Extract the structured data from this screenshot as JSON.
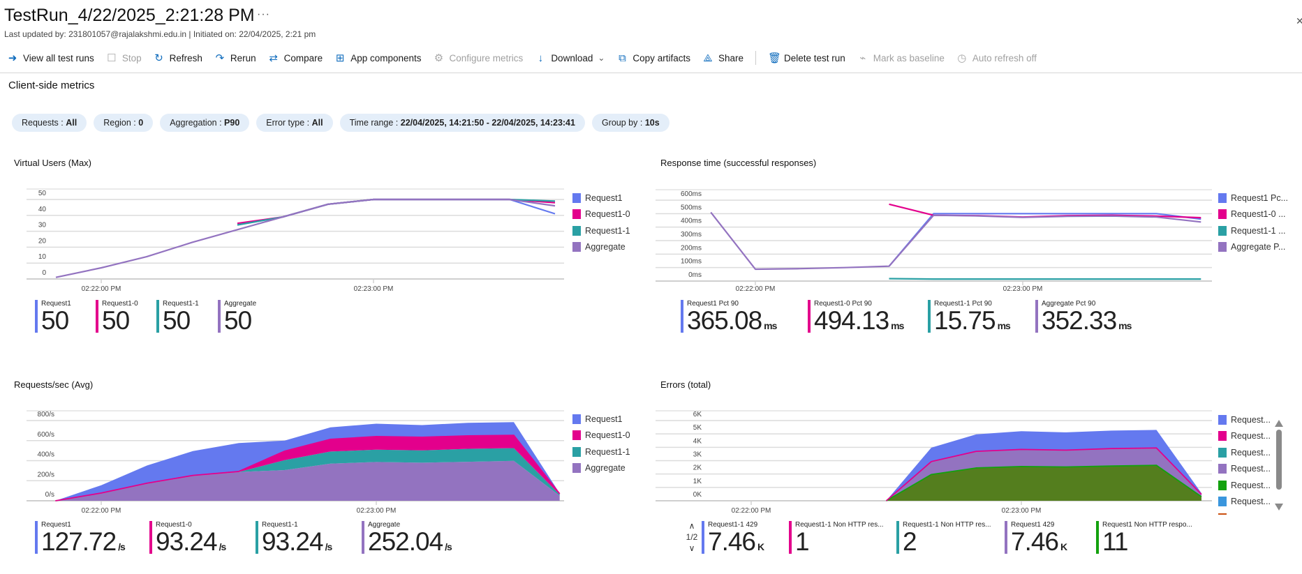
{
  "header": {
    "title": "TestRun_4/22/2025_2:21:28 PM",
    "more": "···",
    "subtitle": "Last updated by: 231801057@rajalakshmi.edu.in | Initiated on: 22/04/2025, 2:21 pm",
    "close": "✕"
  },
  "toolbar": [
    {
      "label": "View all test runs",
      "icon": "arrow-circle-icon",
      "glyph": "➜",
      "disabled": false
    },
    {
      "label": "Stop",
      "icon": "stop-icon",
      "glyph": "☐",
      "disabled": true
    },
    {
      "label": "Refresh",
      "icon": "refresh-icon",
      "glyph": "↻",
      "disabled": false
    },
    {
      "label": "Rerun",
      "icon": "rerun-icon",
      "glyph": "↷",
      "disabled": false
    },
    {
      "label": "Compare",
      "icon": "compare-icon",
      "glyph": "⇄",
      "disabled": false
    },
    {
      "label": "App components",
      "icon": "app-components-icon",
      "glyph": "⊞",
      "disabled": false
    },
    {
      "label": "Configure metrics",
      "icon": "gear-icon",
      "glyph": "⚙",
      "disabled": true
    },
    {
      "label": "Download",
      "icon": "download-icon",
      "glyph": "↓",
      "disabled": false,
      "chevron": "⌄"
    },
    {
      "label": "Copy artifacts",
      "icon": "copy-icon",
      "glyph": "⧉",
      "disabled": false
    },
    {
      "label": "Share",
      "icon": "share-icon",
      "glyph": "⟁",
      "disabled": false
    },
    {
      "label": "Delete test run",
      "icon": "trash-icon",
      "glyph": "🗑",
      "disabled": false
    },
    {
      "label": "Mark as baseline",
      "icon": "baseline-icon",
      "glyph": "⌁",
      "disabled": true
    },
    {
      "label": "Auto refresh off",
      "icon": "clock-icon",
      "glyph": "◷",
      "disabled": true
    }
  ],
  "section_title": "Client-side metrics",
  "filters": [
    {
      "key": "Requests : ",
      "value": "All"
    },
    {
      "key": "Region : ",
      "value": "0"
    },
    {
      "key": "Aggregation : ",
      "value": "P90"
    },
    {
      "key": "Error type : ",
      "value": "All"
    },
    {
      "key": "Time range : ",
      "value": "22/04/2025, 14:21:50 - 22/04/2025, 14:23:41"
    },
    {
      "key": "Group by : ",
      "value": "10s"
    }
  ],
  "colors": {
    "request1": "#6479ef",
    "request1_0": "#e3008c",
    "request1_1": "#2aa0a4",
    "aggregate": "#9373c0",
    "green": "#13a10e",
    "green_fill": "#547e1e",
    "light_blue": "#3a96dd",
    "orange": "#ca5010"
  },
  "chart_data": [
    {
      "type": "line",
      "title": "Virtual Users (Max)",
      "x": [
        "02:21:50",
        "02:22:00",
        "02:22:10",
        "02:22:20",
        "02:22:30",
        "02:22:40",
        "02:22:50",
        "02:23:00",
        "02:23:10",
        "02:23:20",
        "02:23:30",
        "02:23:40"
      ],
      "xtick_labels": [
        "02:22:00 PM",
        "02:23:00 PM"
      ],
      "yticks": [
        0,
        10,
        20,
        30,
        40,
        50
      ],
      "ytick_labels": [
        "0",
        "10",
        "20",
        "30",
        "40",
        "50"
      ],
      "ylim": [
        0,
        50
      ],
      "series": [
        {
          "name": "Request1",
          "color": "#6479ef",
          "values": [
            null,
            null,
            null,
            null,
            34,
            39,
            47,
            50,
            50,
            50,
            50,
            41
          ]
        },
        {
          "name": "Request1-0",
          "color": "#e3008c",
          "values": [
            null,
            null,
            null,
            null,
            35,
            39,
            47,
            50,
            50,
            50,
            50,
            48
          ]
        },
        {
          "name": "Request1-1",
          "color": "#2aa0a4",
          "values": [
            null,
            null,
            null,
            null,
            34,
            39,
            47,
            50,
            50,
            50,
            50,
            49
          ]
        },
        {
          "name": "Aggregate",
          "color": "#9373c0",
          "values": [
            1,
            7,
            14,
            23,
            31,
            39,
            47,
            50,
            50,
            50,
            50,
            46
          ]
        }
      ],
      "legend": [
        "Request1",
        "Request1-0",
        "Request1-1",
        "Aggregate"
      ],
      "stats": [
        {
          "label": "Request1",
          "value": "50",
          "unit": "",
          "color": "#6479ef"
        },
        {
          "label": "Request1-0",
          "value": "50",
          "unit": "",
          "color": "#e3008c"
        },
        {
          "label": "Request1-1",
          "value": "50",
          "unit": "",
          "color": "#2aa0a4"
        },
        {
          "label": "Aggregate",
          "value": "50",
          "unit": "",
          "color": "#9373c0"
        }
      ]
    },
    {
      "type": "line",
      "title": "Response time (successful responses)",
      "x": [
        "02:21:50",
        "02:22:00",
        "02:22:10",
        "02:22:20",
        "02:22:30",
        "02:22:40",
        "02:22:50",
        "02:23:00",
        "02:23:10",
        "02:23:20",
        "02:23:30",
        "02:23:40"
      ],
      "xtick_labels": [
        "02:22:00 PM",
        "02:23:00 PM"
      ],
      "yticks": [
        0,
        100,
        200,
        300,
        400,
        500,
        600
      ],
      "ytick_labels": [
        "0ms",
        "100ms",
        "200ms",
        "300ms",
        "400ms",
        "500ms",
        "600ms"
      ],
      "ylim": [
        0,
        600
      ],
      "series": [
        {
          "name": "Request1 Pct 90",
          "color": "#6479ef",
          "values": [
            null,
            null,
            null,
            null,
            110,
            500,
            500,
            500,
            500,
            500,
            500,
            460
          ]
        },
        {
          "name": "Request1-0 Pct 90",
          "color": "#e3008c",
          "values": [
            null,
            null,
            null,
            null,
            570,
            488,
            485,
            475,
            485,
            488,
            482,
            470
          ]
        },
        {
          "name": "Request1-1 Pct 90",
          "color": "#2aa0a4",
          "values": [
            null,
            null,
            null,
            null,
            18,
            15,
            15,
            15,
            15,
            15,
            15,
            15
          ]
        },
        {
          "name": "Aggregate Pct 90",
          "color": "#9373c0",
          "values": [
            510,
            88,
            92,
            100,
            110,
            488,
            483,
            472,
            480,
            482,
            475,
            438
          ]
        }
      ],
      "legend": [
        "Request1 Pc...",
        "Request1-0 ...",
        "Request1-1 ...",
        "Aggregate P..."
      ],
      "stats": [
        {
          "label": "Request1 Pct 90",
          "value": "365.08",
          "unit": "ms",
          "color": "#6479ef"
        },
        {
          "label": "Request1-0 Pct 90",
          "value": "494.13",
          "unit": "ms",
          "color": "#e3008c"
        },
        {
          "label": "Request1-1 Pct 90",
          "value": "15.75",
          "unit": "ms",
          "color": "#2aa0a4"
        },
        {
          "label": "Aggregate Pct 90",
          "value": "352.33",
          "unit": "ms",
          "color": "#9373c0"
        }
      ]
    },
    {
      "type": "area",
      "stacked": true,
      "title": "Requests/sec (Avg)",
      "x": [
        "02:21:50",
        "02:22:00",
        "02:22:10",
        "02:22:20",
        "02:22:30",
        "02:22:40",
        "02:22:50",
        "02:23:00",
        "02:23:10",
        "02:23:20",
        "02:23:30",
        "02:23:40"
      ],
      "xtick_labels": [
        "02:22:00 PM",
        "02:23:00 PM"
      ],
      "yticks": [
        0,
        200,
        400,
        600,
        800
      ],
      "ytick_labels": [
        "0/s",
        "200/s",
        "400/s",
        "600/s",
        "800/s"
      ],
      "ylim": [
        0,
        800
      ],
      "stack_order": [
        "Aggregate",
        "Request1-1",
        "Request1-0",
        "Request1"
      ],
      "series": [
        {
          "name": "Request1",
          "color": "#6479ef",
          "values": [
            0,
            78,
            177,
            242,
            284,
            105,
            119,
            128,
            121,
            130,
            132,
            4
          ]
        },
        {
          "name": "Request1-0",
          "color": "#e3008c",
          "values": [
            0,
            3,
            4,
            5,
            5,
            90,
            122,
            132,
            132,
            130,
            128,
            8
          ]
        },
        {
          "name": "Request1-1",
          "color": "#2aa0a4",
          "values": [
            0,
            0,
            0,
            0,
            0,
            99,
            121,
            122,
            122,
            129,
            127,
            11
          ]
        },
        {
          "name": "Aggregate",
          "color": "#9373c0",
          "values": [
            0,
            74,
            171,
            248,
            287,
            306,
            370,
            387,
            380,
            389,
            398,
            51
          ]
        }
      ],
      "legend": [
        "Request1",
        "Request1-0",
        "Request1-1",
        "Aggregate"
      ],
      "stats": [
        {
          "label": "Request1",
          "value": "127.72",
          "unit": "/s",
          "color": "#6479ef"
        },
        {
          "label": "Request1-0",
          "value": "93.24",
          "unit": "/s",
          "color": "#e3008c"
        },
        {
          "label": "Request1-1",
          "value": "93.24",
          "unit": "/s",
          "color": "#2aa0a4"
        },
        {
          "label": "Aggregate",
          "value": "252.04",
          "unit": "/s",
          "color": "#9373c0"
        }
      ]
    },
    {
      "type": "area",
      "stacked": true,
      "title": "Errors (total)",
      "x": [
        "02:22:30",
        "02:22:40",
        "02:22:50",
        "02:23:00",
        "02:23:10",
        "02:23:20",
        "02:23:30",
        "02:23:40"
      ],
      "xtick_labels": [
        "02:22:00 PM",
        "02:23:00 PM"
      ],
      "yticks": [
        0,
        1000,
        2000,
        3000,
        4000,
        5000,
        6000
      ],
      "ytick_labels": [
        "0K",
        "1K",
        "2K",
        "3K",
        "4K",
        "5K",
        "6K"
      ],
      "ylim": [
        0,
        6000
      ],
      "stack_order": [
        "Request1 Non HTTP respo...",
        "Request1-1 Non HTTP res... (2)",
        "Request1 429",
        "Request1-1 Non HTTP res...",
        "Request1-1 429"
      ],
      "series": [
        {
          "name": "Request1-1 429",
          "color": "#6479ef",
          "values": [
            0,
            1040,
            1270,
            1360,
            1330,
            1340,
            1350,
            90
          ]
        },
        {
          "name": "Request1-1 Non HTTP res...",
          "color": "#e3008c",
          "values": [
            0,
            20,
            20,
            20,
            20,
            20,
            20,
            10
          ]
        },
        {
          "name": "Request1-1 Non HTTP res... (2)",
          "color": "#2aa0a4",
          "values": [
            0,
            0,
            0,
            0,
            0,
            0,
            0,
            0
          ]
        },
        {
          "name": "Request1 429",
          "color": "#9373c0",
          "values": [
            0,
            950,
            1220,
            1260,
            1240,
            1290,
            1280,
            170
          ]
        },
        {
          "name": "Request1 Non HTTP respo...",
          "color": "#13a10e",
          "fill": "#547e1e",
          "values": [
            0,
            1960,
            2460,
            2560,
            2530,
            2600,
            2650,
            300
          ]
        }
      ],
      "legend": [
        "Request...",
        "Request...",
        "Request...",
        "Request...",
        "Request...",
        "Request...",
        "Request..."
      ],
      "legend_colors": [
        "#6479ef",
        "#e3008c",
        "#2aa0a4",
        "#9373c0",
        "#13a10e",
        "#3a96dd",
        "#ca5010"
      ],
      "pager": {
        "up": "∧",
        "label": "1/2",
        "down": "∨"
      },
      "stats": [
        {
          "label": "Request1-1 429",
          "value": "7.46",
          "unit": "K",
          "color": "#6479ef"
        },
        {
          "label": "Request1-1 Non HTTP res...",
          "value": "1",
          "unit": "",
          "color": "#e3008c"
        },
        {
          "label": "Request1-1 Non HTTP res...",
          "value": "2",
          "unit": "",
          "color": "#2aa0a4"
        },
        {
          "label": "Request1 429",
          "value": "7.46",
          "unit": "K",
          "color": "#9373c0"
        },
        {
          "label": "Request1 Non HTTP respo...",
          "value": "11",
          "unit": "",
          "color": "#13a10e"
        }
      ]
    }
  ]
}
